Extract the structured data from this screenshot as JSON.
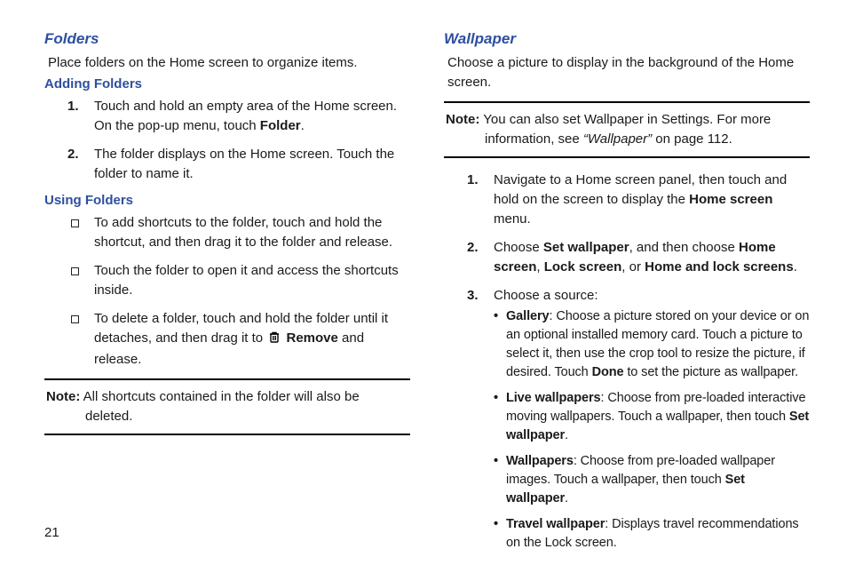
{
  "page_number": "21",
  "left": {
    "section": "Folders",
    "intro": "Place folders on the Home screen to organize items.",
    "sub1": "Adding Folders",
    "add": [
      {
        "n": "1.",
        "before": "Touch and hold an empty area of the Home screen. On the pop-up menu, touch ",
        "bold": "Folder",
        "after": "."
      },
      {
        "n": "2.",
        "before": "The folder displays on the Home screen. Touch the folder to name it.",
        "bold": "",
        "after": ""
      }
    ],
    "sub2": "Using Folders",
    "use": [
      "To add shortcuts to the folder, touch and hold the shortcut, and then drag it to the folder and release.",
      "Touch the folder to open it and access the shortcuts inside."
    ],
    "use_del_before": "To delete a folder, touch and hold the folder until it detaches, and then drag it to ",
    "use_del_bold": "Remove",
    "use_del_after": " and release.",
    "note_label": "Note:",
    "note_text": " All shortcuts contained in the folder will also be deleted."
  },
  "right": {
    "section": "Wallpaper",
    "intro": "Choose a picture to display in the background of the Home screen.",
    "note_label": "Note:",
    "note_l1": " You can also set Wallpaper in Settings. For more ",
    "note_l2a": "information, see ",
    "note_italic": "“Wallpaper”",
    "note_l2b": " on page 112.",
    "steps": {
      "s1_before": "Navigate to a Home screen panel, then touch and hold on the screen to display the ",
      "s1_bold": "Home screen",
      "s1_after": " menu.",
      "s2_a": "Choose ",
      "s2_b1": "Set wallpaper",
      "s2_c": ", and then choose ",
      "s2_b2": "Home screen",
      "s2_d": ", ",
      "s2_b3": "Lock screen",
      "s2_e": ", or ",
      "s2_b4": "Home and lock screens",
      "s2_f": ".",
      "s3": "Choose a source:"
    },
    "sources": {
      "g_b": "Gallery",
      "g_t": ": Choose a picture stored on your device or on an optional installed memory card. Touch a picture to select it, then use the crop tool to resize the picture, if desired. Touch ",
      "g_b2": "Done",
      "g_t2": " to set the picture as wallpaper.",
      "l_b": "Live wallpapers",
      "l_t": ": Choose from pre-loaded interactive moving wallpapers. Touch a wallpaper, then touch ",
      "l_b2": "Set wallpaper",
      "l_t2": ".",
      "w_b": "Wallpapers",
      "w_t": ": Choose from pre-loaded wallpaper images. Touch a wallpaper, then touch ",
      "w_b2": "Set wallpaper",
      "w_t2": ".",
      "t_b": "Travel wallpaper",
      "t_t": ": Displays travel recommendations on the Lock screen."
    }
  }
}
